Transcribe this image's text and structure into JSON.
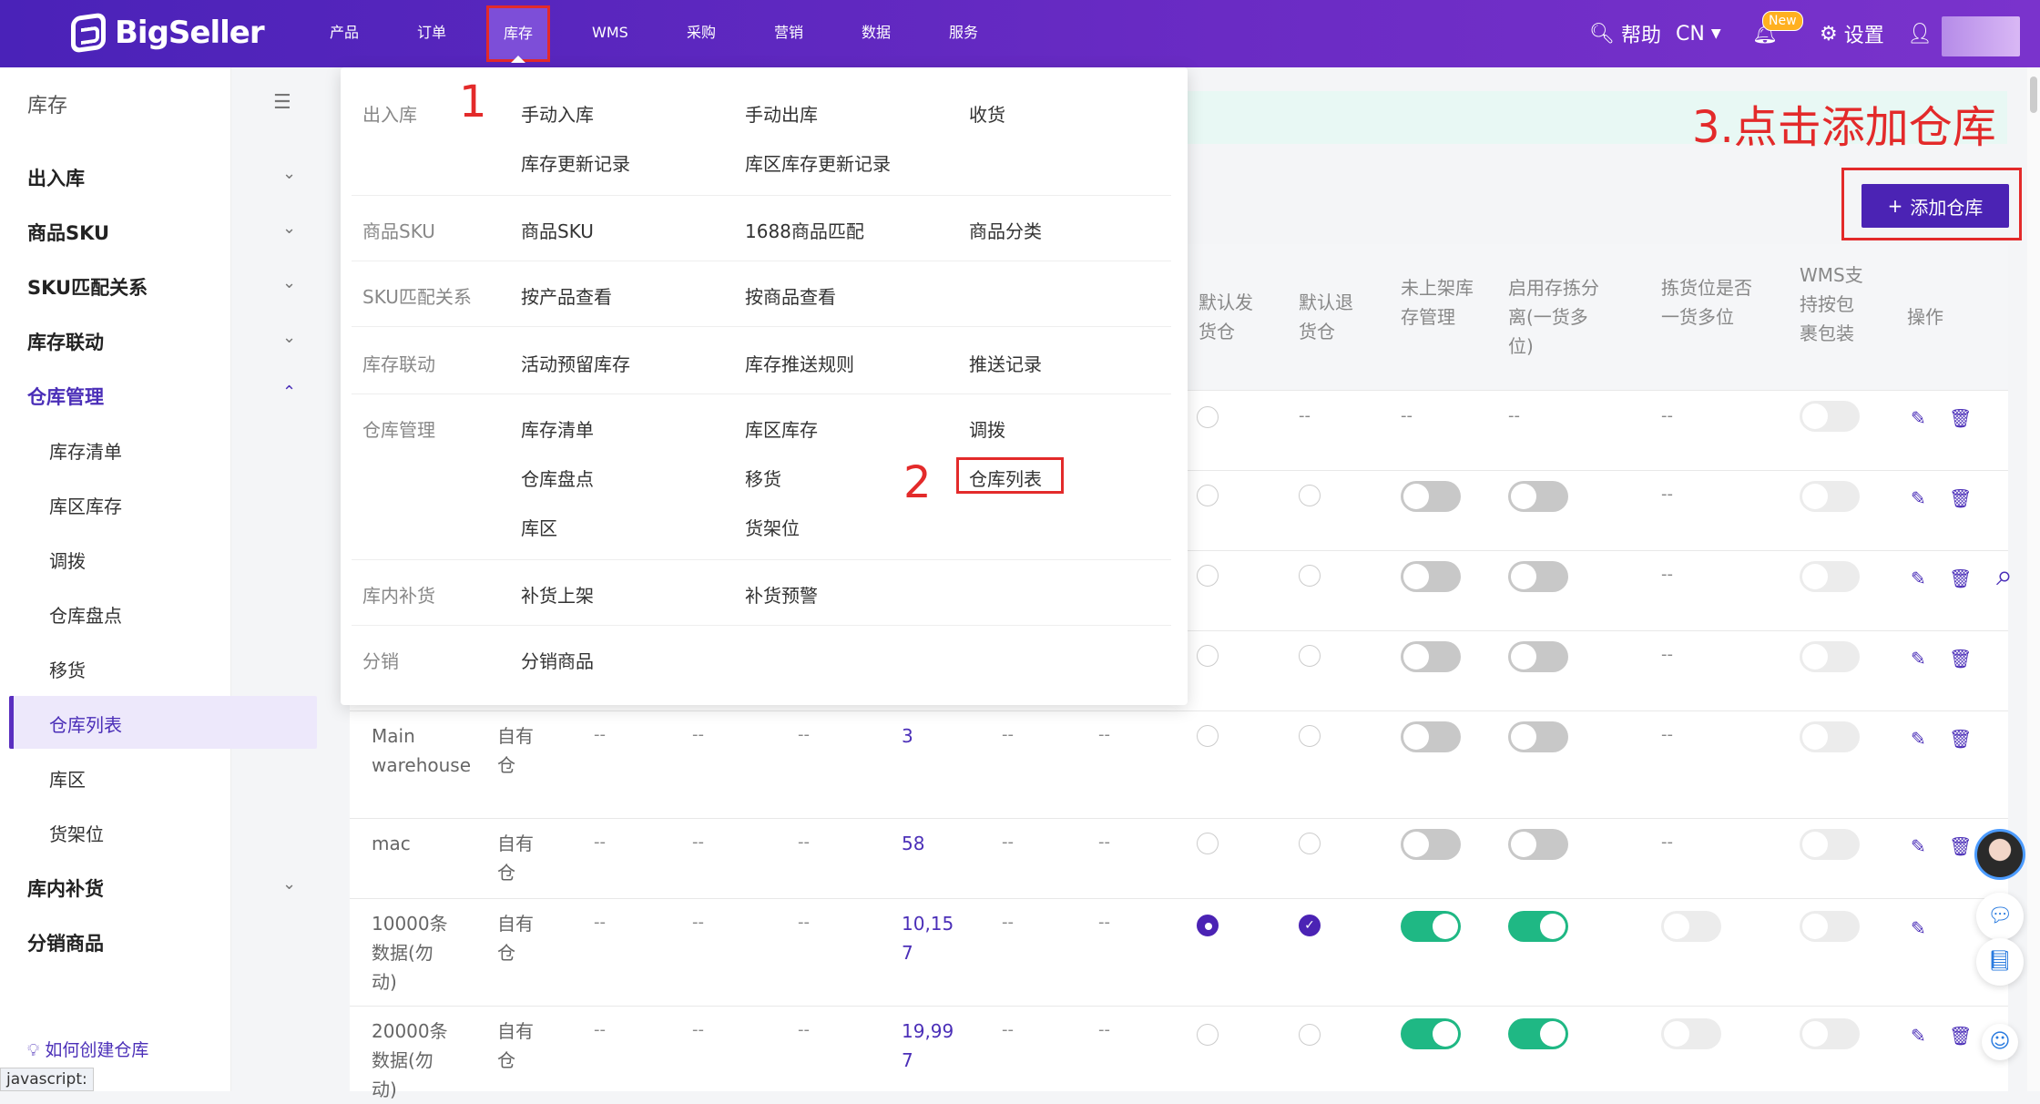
{
  "brand": {
    "name": "BigSeller"
  },
  "nav": {
    "items": [
      "产品",
      "订单",
      "库存",
      "WMS",
      "采购",
      "营销",
      "数据",
      "服务"
    ],
    "active": "库存"
  },
  "topright": {
    "help": "帮助",
    "lang": "CN",
    "new_badge": "New",
    "settings": "设置"
  },
  "sidebar": {
    "title": "库存",
    "groups": [
      "出入库",
      "商品SKU",
      "SKU匹配关系",
      "库存联动",
      "仓库管理"
    ],
    "sub": [
      "库存清单",
      "库区库存",
      "调拨",
      "仓库盘点",
      "移货",
      "仓库列表",
      "库区",
      "货架位"
    ],
    "groups2": [
      "库内补货",
      "分销商品"
    ],
    "tip": "如何创建仓库",
    "status": "javascript:"
  },
  "dropdown": {
    "cats": [
      "出入库",
      "商品SKU",
      "SKU匹配关系",
      "库存联动",
      "仓库管理",
      "库内补货",
      "分销"
    ],
    "links": {
      "inout": [
        "手动入库",
        "手动出库",
        "收货",
        "库存更新记录",
        "库区库存更新记录"
      ],
      "sku": [
        "商品SKU",
        "1688商品匹配",
        "商品分类"
      ],
      "match": [
        "按产品查看",
        "按商品查看"
      ],
      "sync": [
        "活动预留库存",
        "库存推送规则",
        "推送记录"
      ],
      "wh": [
        "库存清单",
        "库区库存",
        "调拨",
        "仓库盘点",
        "移货",
        "仓库列表",
        "库区",
        "货架位"
      ],
      "replen": [
        "补货上架",
        "补货预警"
      ],
      "dist": [
        "分销商品"
      ]
    }
  },
  "annotations": {
    "a1": "1",
    "a2": "2",
    "a3": "3.点击添加仓库"
  },
  "add_button": "添加仓库",
  "table": {
    "headers": [
      "默认发货仓",
      "默认退货仓",
      "未上架库存管理",
      "启用存拣分离(一货多位)",
      "拣货位是否一货多位",
      "WMS支持按包裹包装",
      "操作"
    ],
    "rows": [
      {
        "name": "Main warehouse",
        "type": "自有仓",
        "count": "3"
      },
      {
        "name": "mac",
        "type": "自有仓",
        "count": "58"
      },
      {
        "name": "10000条数据(勿动)",
        "type": "自有仓",
        "count": "10,157"
      },
      {
        "name": "20000条数据(勿动)",
        "type": "自有仓",
        "count": "19,997"
      }
    ],
    "dash": "--"
  },
  "colors": {
    "brand": "#5a2fc0",
    "accent_red": "#e32a2a",
    "toggle_on": "#1fb884"
  }
}
